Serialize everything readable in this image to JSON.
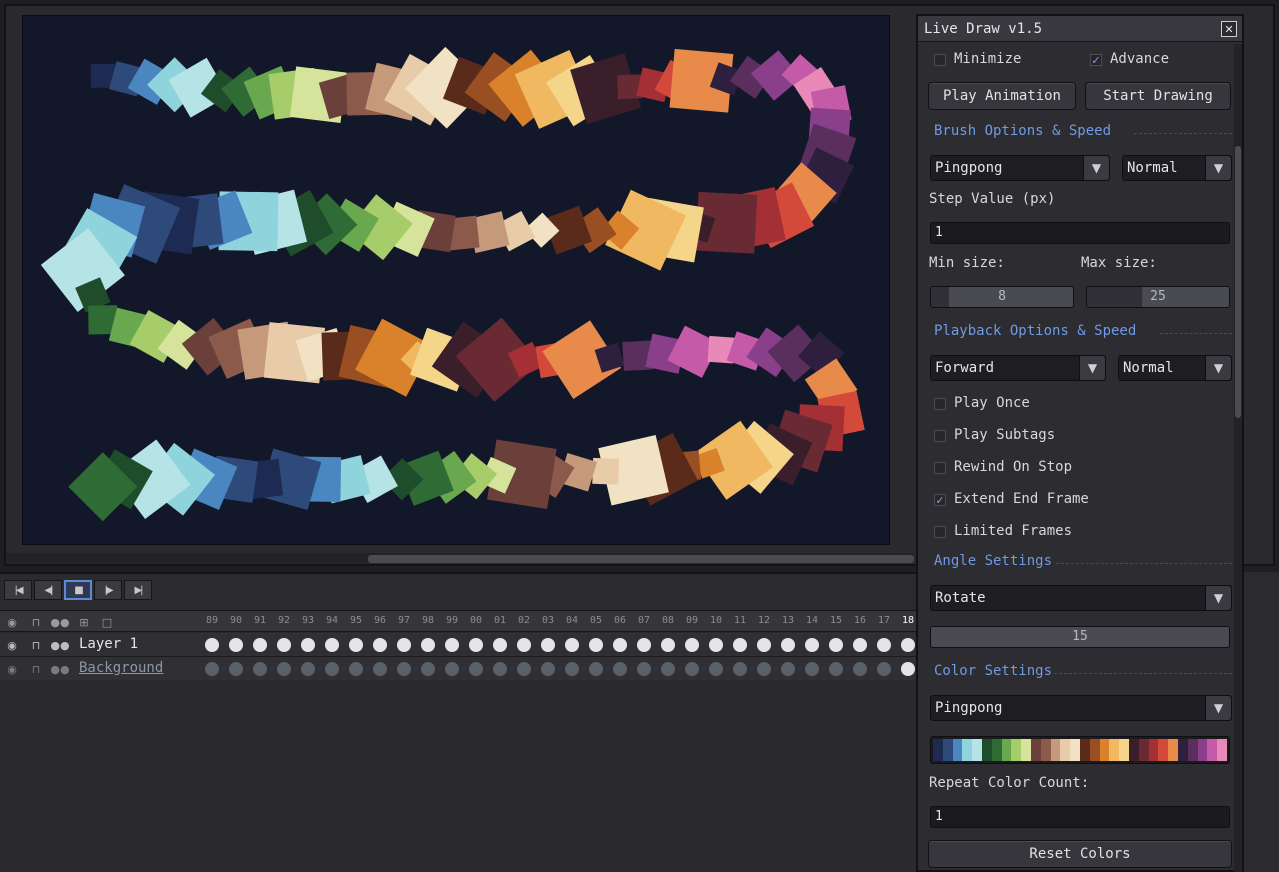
{
  "timeline": {
    "layers": [
      {
        "name": "Layer 1",
        "linked": false
      },
      {
        "name": "Background",
        "linked": true
      }
    ],
    "frame_numbers": [
      "89",
      "90",
      "91",
      "92",
      "93",
      "94",
      "95",
      "96",
      "97",
      "98",
      "99",
      "00",
      "01",
      "02",
      "03",
      "04",
      "05",
      "06",
      "07",
      "08",
      "09",
      "10",
      "11",
      "12",
      "13",
      "14",
      "15",
      "16",
      "17",
      "18"
    ],
    "current_frame_label": "18"
  },
  "dialog": {
    "title": "Live Draw v1.5",
    "close_glyph": "✕",
    "minimize": {
      "label": "Minimize",
      "checked": false
    },
    "advance": {
      "label": "Advance",
      "checked": true
    },
    "play_animation_label": "Play Animation",
    "start_drawing_label": "Start Drawing",
    "brush_section": "Brush Options & Speed",
    "brush_mode": "Pingpong",
    "brush_speed": "Normal",
    "step_value_label": "Step Value (px)",
    "step_value": "1",
    "min_size_label": "Min size:",
    "max_size_label": "Max size:",
    "min_size": 8,
    "max_size": 25,
    "min_size_text": "8",
    "max_size_text": "25",
    "playback_section": "Playback Options & Speed",
    "playback_direction": "Forward",
    "playback_speed": "Normal",
    "options": [
      {
        "label": "Play Once",
        "checked": false
      },
      {
        "label": "Play Subtags",
        "checked": false
      },
      {
        "label": "Rewind On Stop",
        "checked": false
      },
      {
        "label": "Extend End Frame",
        "checked": true
      },
      {
        "label": "Limited Frames",
        "checked": false
      }
    ],
    "angle_section": "Angle Settings",
    "angle_mode": "Rotate",
    "angle_value": 15,
    "angle_value_text": "15",
    "color_section": "Color Settings",
    "color_mode": "Pingpong",
    "palette": [
      "#1d2b53",
      "#2e4a7a",
      "#4a86c0",
      "#8fd3dc",
      "#b6e3e6",
      "#1f4d2c",
      "#2e6b35",
      "#6aa84f",
      "#a7cc6a",
      "#d6e39a",
      "#6b3f3a",
      "#8c5a4a",
      "#c49a7a",
      "#e8cba8",
      "#f2e2c4",
      "#5a2a1a",
      "#9a4f22",
      "#d9822b",
      "#f0b860",
      "#f5d58a",
      "#3a1f2a",
      "#6a2a34",
      "#a42f34",
      "#d44a3a",
      "#e88a4a",
      "#2e1f3e",
      "#5a2f5e",
      "#8a3f8a",
      "#c45aa8",
      "#e889b8"
    ],
    "repeat_color_label": "Repeat Color Count:",
    "repeat_color_value": "1",
    "reset_colors_label": "Reset Colors",
    "check_glyph": "✓",
    "dropdown_glyph": "▼"
  }
}
